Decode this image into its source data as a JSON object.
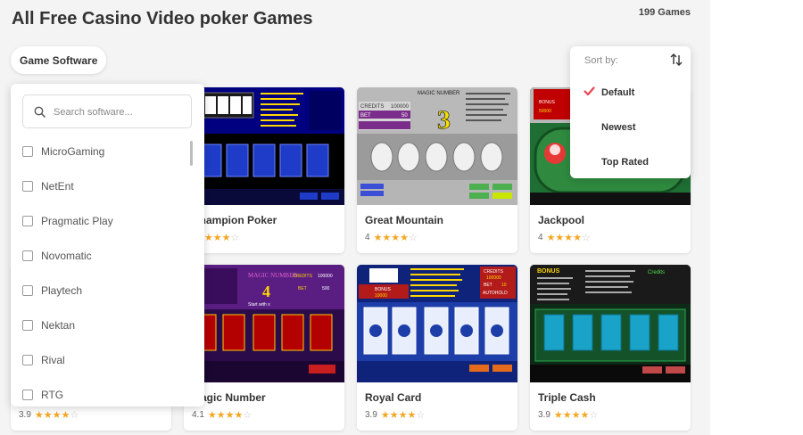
{
  "header": {
    "title": "All Free Casino Video poker Games",
    "count": "199 Games"
  },
  "filters": {
    "software_label": "Game Software"
  },
  "software_dropdown": {
    "placeholder": "Search software...",
    "items": [
      "MicroGaming",
      "NetEnt",
      "Pragmatic Play",
      "Novomatic",
      "Playtech",
      "Nektan",
      "Rival",
      "RTG"
    ]
  },
  "sort": {
    "label": "Sort by:",
    "options": [
      "Default",
      "Newest",
      "Top Rated"
    ],
    "selected": "Default"
  },
  "games": [
    {
      "title": "Champion Poker",
      "rating": "",
      "stars": 4
    },
    {
      "title": "Great Mountain",
      "rating": "4",
      "stars": 4
    },
    {
      "title": "Jackpool",
      "rating": "4",
      "stars": 4
    },
    {
      "title": "",
      "rating": "3.9",
      "stars": 4
    },
    {
      "title": "Magic Number",
      "rating": "4.1",
      "stars": 4
    },
    {
      "title": "Royal Card",
      "rating": "3.9",
      "stars": 4
    },
    {
      "title": "Triple Cash",
      "rating": "3.9",
      "stars": 4
    }
  ],
  "thumb_texts": {
    "great_mountain_header": "MAGIC NUMBER",
    "great_mountain_digit": "3",
    "great_mountain_credits": "CREDITS",
    "great_mountain_credits_value": "100000",
    "great_mountain_bet": "BET",
    "great_mountain_bet_value": "50",
    "jackpool_bonus": "BONUS",
    "jackpool_bonus_value": "50000",
    "magic_title": "MAGIC NUMBER",
    "magic_digit": "4",
    "magic_start": "Start with x",
    "magic_credits": "CREDITS",
    "magic_credits_value": "100000",
    "magic_bet": "BET",
    "magic_bet_value": "500",
    "royal_bonus": "BONUS",
    "royal_bonus_value": "10000",
    "royal_credits": "CREDITS",
    "royal_credits_value": "100000",
    "royal_bet": "BET",
    "royal_bet_value": "10",
    "royal_autohold": "AUTOHOLD",
    "triple_bonus": "BONUS",
    "triple_credits": "Credits"
  },
  "colors": {
    "star": "#f5a623",
    "check": "#e8434f"
  }
}
